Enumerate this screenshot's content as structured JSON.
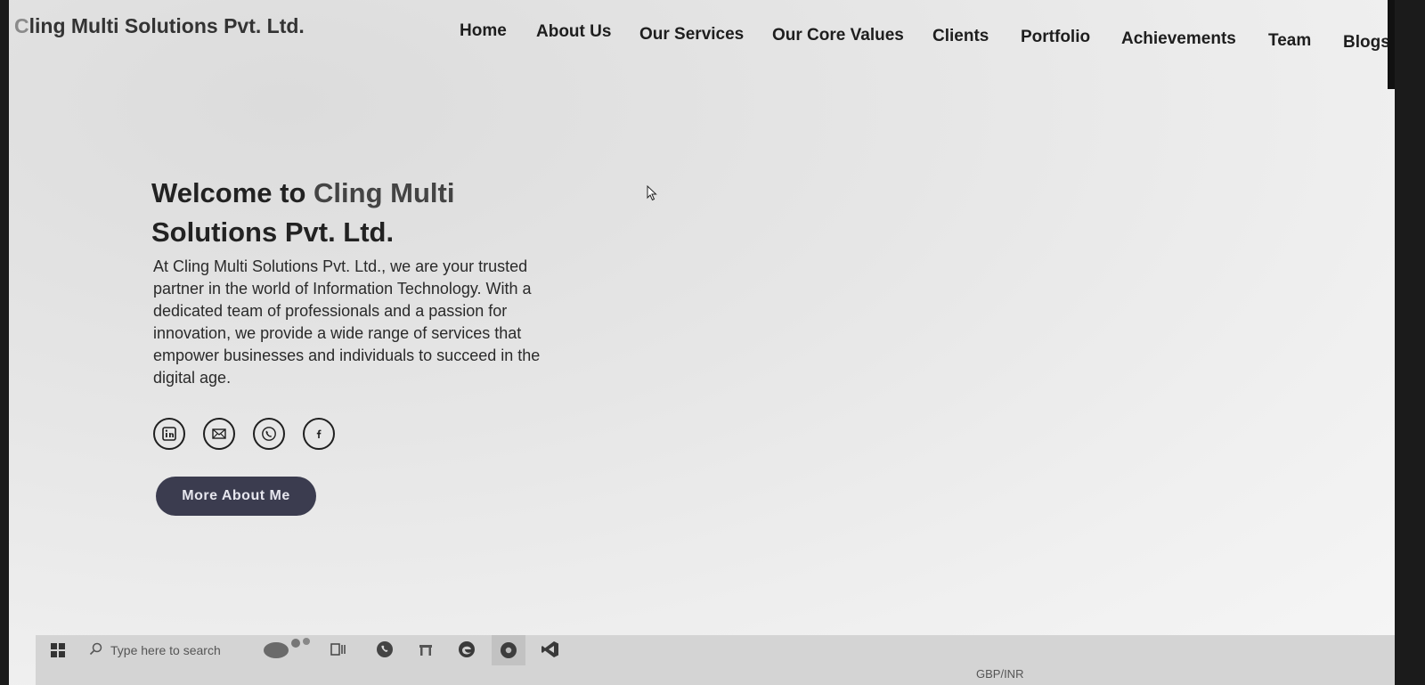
{
  "brand": {
    "name_first": "C",
    "name_rest": "ling Multi Solutions Pvt. Ltd."
  },
  "nav": {
    "items": [
      {
        "label": "Home"
      },
      {
        "label": "About Us"
      },
      {
        "label": "Our Services"
      },
      {
        "label": "Our Core Values"
      },
      {
        "label": "Clients"
      },
      {
        "label": "Portfolio"
      },
      {
        "label": "Achievements"
      },
      {
        "label": "Team"
      },
      {
        "label": "Blogs"
      }
    ]
  },
  "hero": {
    "title_start": "Welcome to ",
    "title_accent": "Cling Multi",
    "title_end": "Solutions Pvt. Ltd.",
    "description": "At Cling Multi Solutions Pvt. Ltd., we are your trusted partner in the world of Information Technology. With a dedicated team of professionals and a passion for innovation, we provide a wide range of services that empower businesses and individuals to succeed in the digital age.",
    "cta_label": "More About Me"
  },
  "socials": [
    {
      "icon": "linkedin-icon"
    },
    {
      "icon": "mail-icon"
    },
    {
      "icon": "phone-icon"
    },
    {
      "icon": "facebook-icon"
    }
  ],
  "taskbar": {
    "search_placeholder": "Type here to search",
    "ticker": "GBP/INR"
  },
  "colors": {
    "button_bg": "#3b3c4f",
    "text": "#222222",
    "background": "#ececec"
  }
}
